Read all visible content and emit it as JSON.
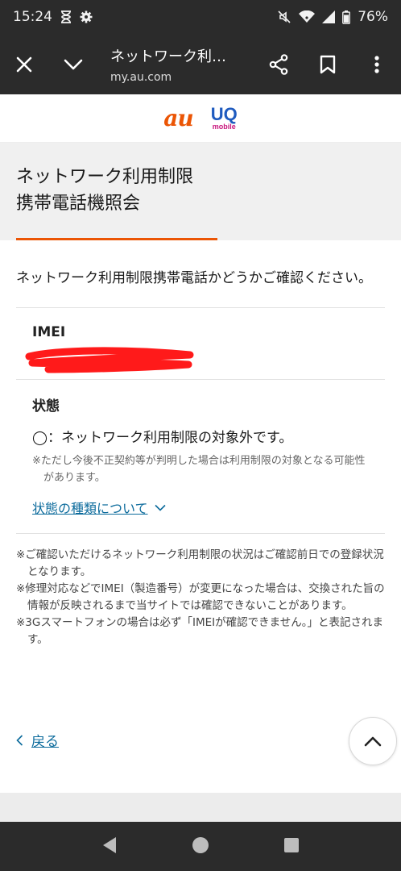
{
  "status_bar": {
    "time": "15:24",
    "battery": "76%",
    "icons": [
      "hourglass-icon",
      "gear-icon",
      "mute-icon",
      "wifi-icon",
      "signal-icon",
      "battery-icon"
    ]
  },
  "browser": {
    "tab_title": "ネットワーク利…",
    "url": "my.au.com"
  },
  "brand": {
    "au": "au",
    "uq": "UQ",
    "uq_sub": "mobile"
  },
  "page": {
    "title_line1": "ネットワーク利用制限",
    "title_line2": "携帯電話機照会",
    "intro": "ネットワーク利用制限携帯電話かどうかご確認ください。",
    "imei_label": "IMEI",
    "status_label": "状態",
    "status_value": "◯：ネットワーク利用制限の対象外です。",
    "status_note": "※ただし今後不正契約等が判明した場合は利用制限の対象となる可能性があります。",
    "types_link": "状態の種類について",
    "notes": [
      "※ご確認いただけるネットワーク利用制限の状況はご確認前日での登録状況となります。",
      "※修理対応などでIMEI（製造番号）が変更になった場合は、交換された旨の情報が反映されるまで当サイトでは確認できないことがあります。",
      "※3Gスマートフォンの場合は必ず「IMEIが確認できません。」と表記されます。"
    ],
    "back_label": "戻る"
  },
  "colors": {
    "accent": "#eb5505",
    "link": "#0c6b9c",
    "redaction": "#ff1a1a"
  }
}
